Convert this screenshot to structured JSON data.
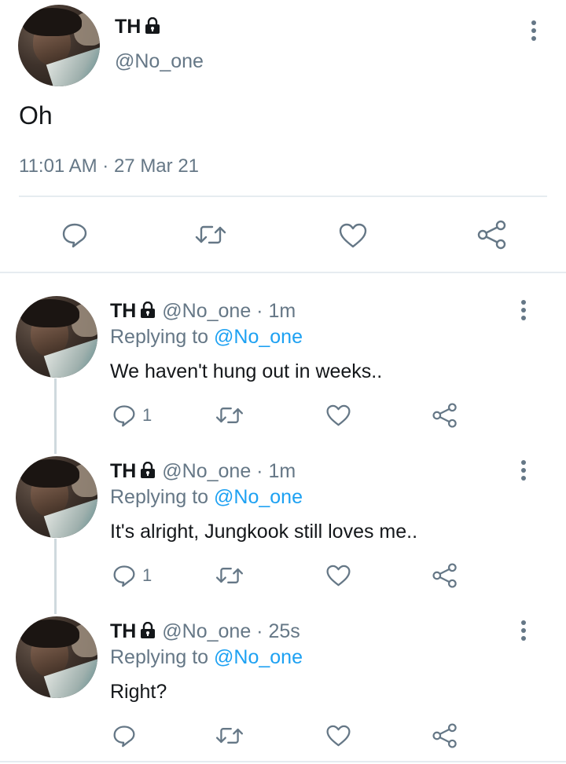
{
  "main_tweet": {
    "name": "TH",
    "handle": "@No_one",
    "text": "Oh",
    "timestamp": "11:01 AM · 27 Mar 21"
  },
  "replies": [
    {
      "name": "TH",
      "handle_time": "@No_one · 1m",
      "replying_prefix": "Replying to",
      "replying_to": "@No_one",
      "text": "We haven't hung out in weeks..",
      "reply_count": "1"
    },
    {
      "name": "TH",
      "handle_time": "@No_one · 1m",
      "replying_prefix": "Replying to",
      "replying_to": "@No_one",
      "text": "It's alright, Jungkook still loves me..",
      "reply_count": "1"
    },
    {
      "name": "TH",
      "handle_time": "@No_one · 25s",
      "replying_prefix": "Replying to",
      "replying_to": "@No_one",
      "text": "Right?",
      "reply_count": ""
    }
  ],
  "colors": {
    "text": "#14171a",
    "secondary": "#657786",
    "accent": "#1da1f2",
    "divider": "#e6ecf0"
  },
  "icons": [
    "lock-icon",
    "more-icon",
    "reply-icon",
    "retweet-icon",
    "like-icon",
    "share-icon"
  ]
}
